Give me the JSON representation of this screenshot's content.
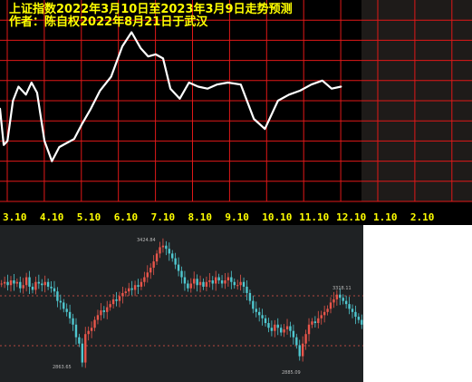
{
  "chart_data": [
    {
      "type": "line",
      "title": "上证指数2022年3月10日至2023年3月9日走势预测",
      "subtitle": "作者：陈自权2022年8月21日于武汉",
      "xlabel": "",
      "ylabel": "",
      "x_ticks": [
        "3.10",
        "4.10",
        "5.10",
        "6.10",
        "7.10",
        "8.10",
        "9.10",
        "10.10",
        "11.10",
        "12.10",
        "1.10",
        "2.10"
      ],
      "y_range": [
        0,
        100
      ],
      "grid": true,
      "forecast_end": "12.10",
      "series": [
        {
          "values_x": [
            0,
            0.1,
            0.2,
            0.35,
            0.5,
            0.6,
            0.7,
            0.85,
            1.0,
            1.2,
            1.4,
            1.6,
            1.8,
            2.0,
            2.2,
            2.45,
            2.7,
            3.0,
            3.3,
            3.55,
            3.8,
            4.0,
            4.2,
            4.4,
            4.6,
            4.85,
            5.1,
            5.35,
            5.6,
            5.85,
            6.15,
            6.5,
            6.85,
            7.15,
            7.5,
            7.8,
            8.1,
            8.4,
            8.7,
            8.95,
            9.2
          ],
          "values_y": [
            46,
            28,
            30,
            50,
            57,
            55,
            53,
            59,
            54,
            30,
            20,
            27,
            29,
            31,
            38,
            46,
            55,
            62,
            77,
            84,
            76,
            72,
            73,
            71,
            56,
            51,
            59,
            57,
            56,
            58,
            59,
            58,
            41,
            36,
            50,
            53,
            55,
            58,
            60,
            56,
            57
          ]
        }
      ]
    },
    {
      "type": "candlestick",
      "title": "",
      "xlabel": "",
      "ylabel": "",
      "grid": false,
      "reference_lines": 2,
      "annotations": [
        "3424.84",
        "2863.65",
        "2885.09",
        "3318.11"
      ],
      "close_values": [
        56,
        57,
        55,
        58,
        56,
        57,
        53,
        55,
        60,
        54,
        52,
        57,
        56,
        55,
        57,
        54,
        53,
        51,
        45,
        44,
        40,
        38,
        34,
        30,
        22,
        18,
        6,
        24,
        26,
        28,
        33,
        36,
        39,
        38,
        41,
        43,
        46,
        45,
        48,
        50,
        51,
        53,
        52,
        55,
        54,
        57,
        60,
        63,
        66,
        70,
        75,
        79,
        80,
        78,
        75,
        72,
        68,
        64,
        60,
        56,
        53,
        56,
        59,
        55,
        57,
        54,
        57,
        58,
        56,
        60,
        58,
        56,
        58,
        60,
        57,
        55,
        55,
        57,
        54,
        50,
        45,
        40,
        38,
        36,
        34,
        31,
        28,
        26,
        30,
        28,
        25,
        27,
        29,
        26,
        22,
        17,
        10,
        18,
        24,
        30,
        32,
        31,
        34,
        36,
        38,
        40,
        44,
        46,
        49,
        47,
        45,
        43,
        40,
        38,
        35,
        33,
        30
      ]
    }
  ],
  "colors": {
    "top_bg": "#000000",
    "dark_panel": "#1e1b19",
    "grid": "#e01818",
    "title": "#ffff00",
    "line": "#ffffff",
    "tick_label": "#ffff00",
    "bottom_bg": "#1f2224",
    "up": "#e8554a",
    "down": "#4fc7cf",
    "annotation": "#b8b8b8"
  }
}
